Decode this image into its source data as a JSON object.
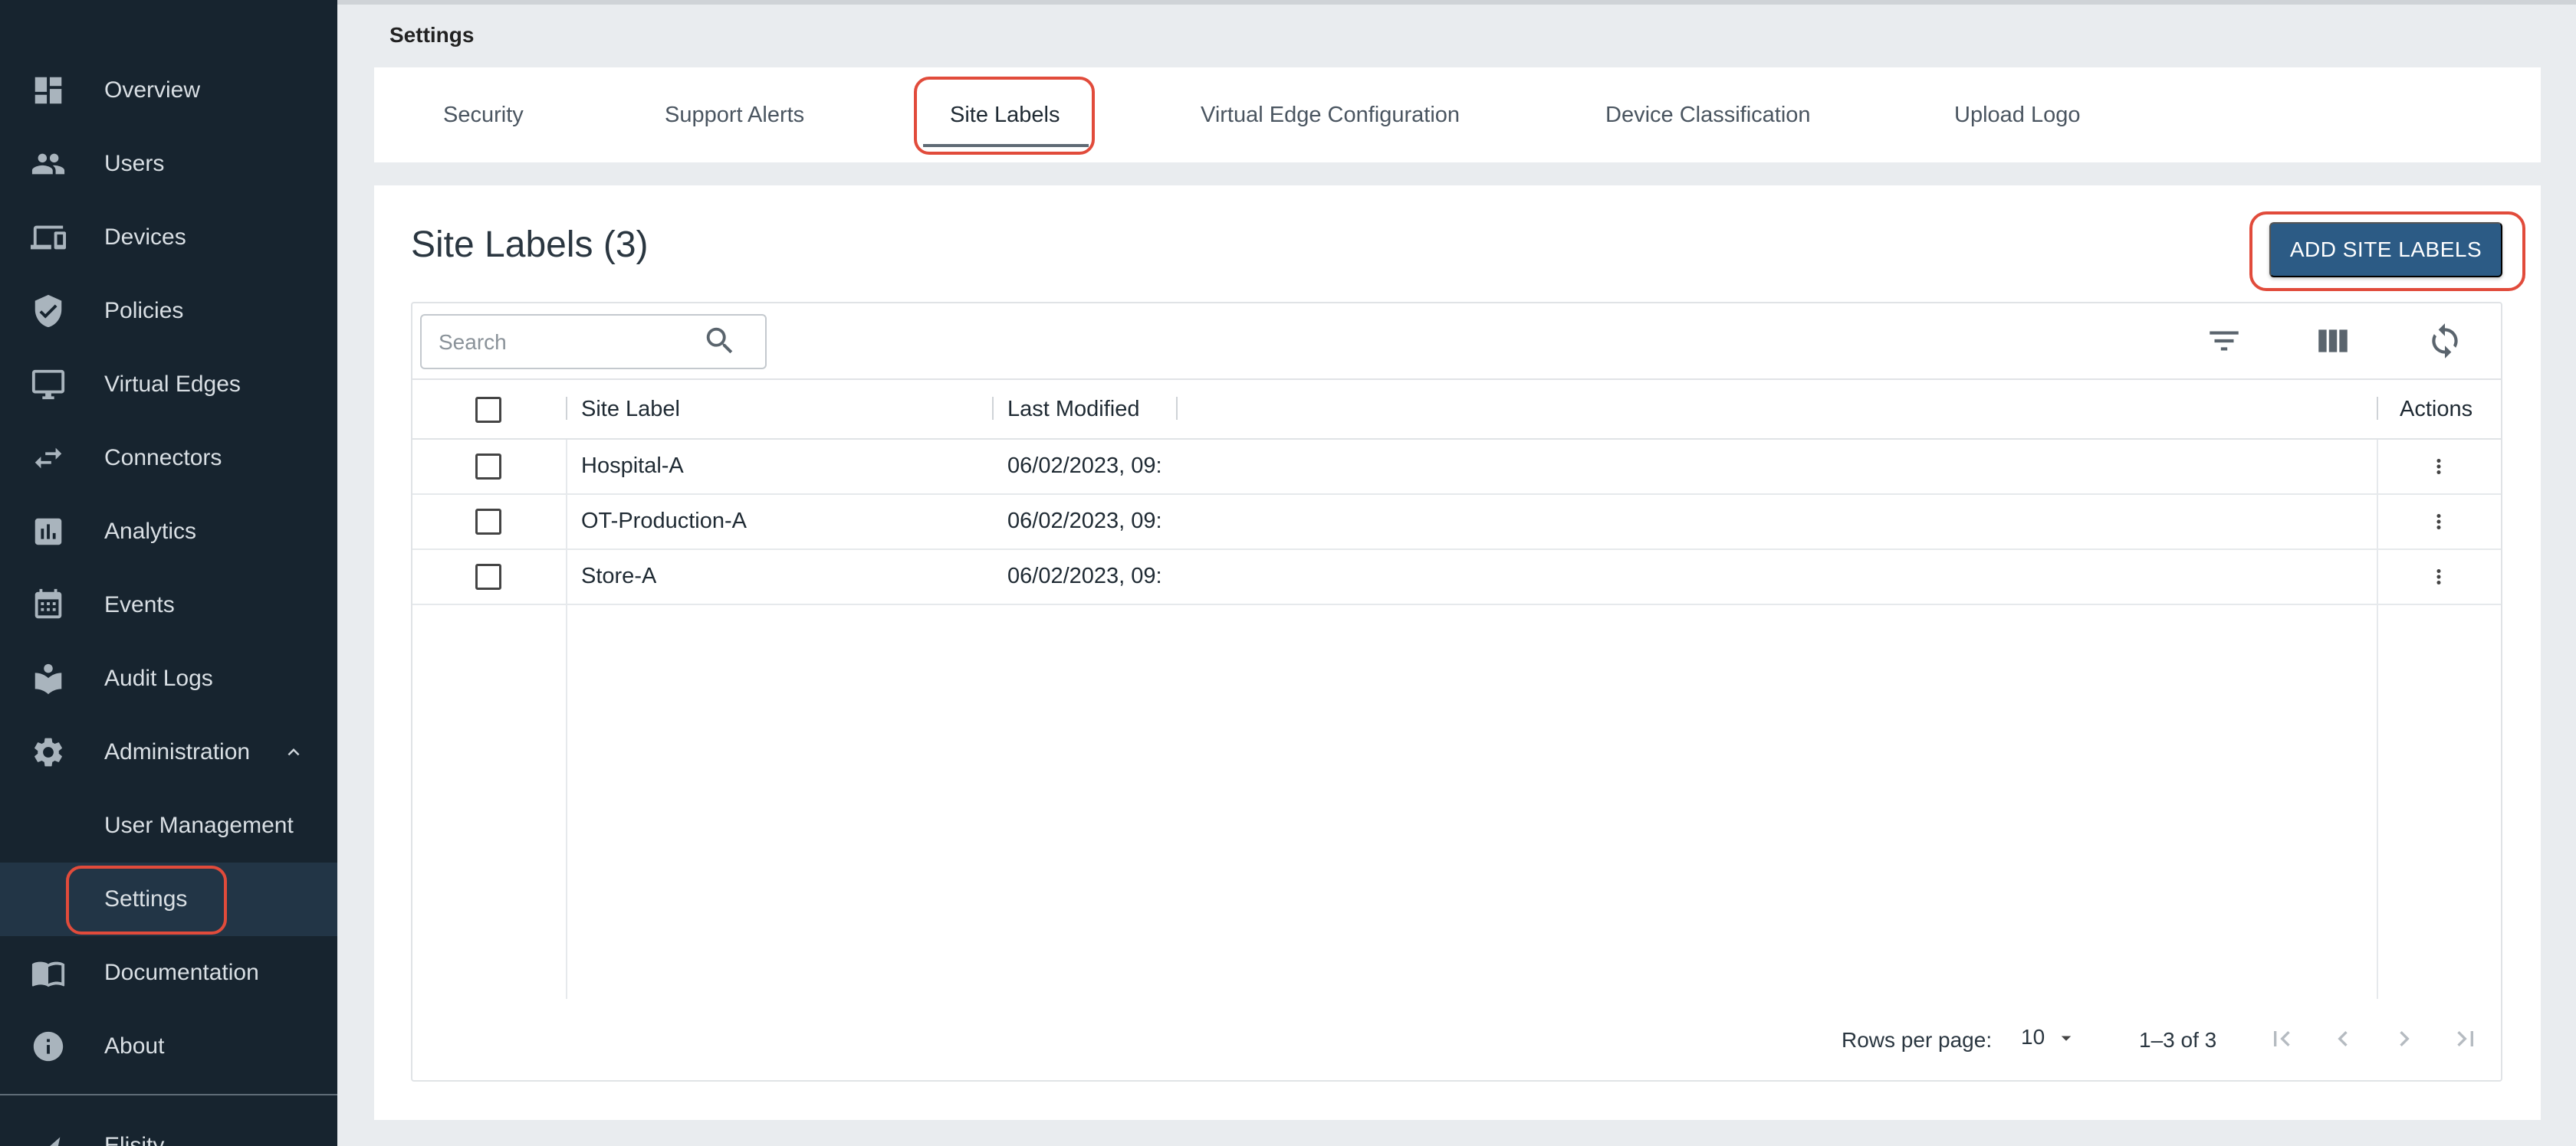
{
  "sidebar": {
    "items": [
      {
        "label": "Overview",
        "icon": "dashboard-icon"
      },
      {
        "label": "Users",
        "icon": "users-icon"
      },
      {
        "label": "Devices",
        "icon": "devices-icon"
      },
      {
        "label": "Policies",
        "icon": "shield-check-icon"
      },
      {
        "label": "Virtual Edges",
        "icon": "monitor-icon"
      },
      {
        "label": "Connectors",
        "icon": "swap-arrows-icon"
      },
      {
        "label": "Analytics",
        "icon": "bar-chart-icon"
      },
      {
        "label": "Events",
        "icon": "calendar-icon"
      },
      {
        "label": "Audit Logs",
        "icon": "book-icon"
      },
      {
        "label": "Administration",
        "icon": "gear-icon"
      },
      {
        "label": "User Management"
      },
      {
        "label": "Settings",
        "selected": true
      },
      {
        "label": "Documentation",
        "icon": "menu-book-icon"
      },
      {
        "label": "About",
        "icon": "info-icon"
      }
    ],
    "footer_label": "Elisity"
  },
  "page": {
    "title": "Settings"
  },
  "tabs": [
    {
      "label": "Security"
    },
    {
      "label": "Support Alerts"
    },
    {
      "label": "Site Labels",
      "active": true
    },
    {
      "label": "Virtual Edge Configuration"
    },
    {
      "label": "Device Classification"
    },
    {
      "label": "Upload Logo"
    }
  ],
  "section": {
    "title": "Site Labels (3)",
    "add_button_label": "ADD SITE LABELS"
  },
  "search": {
    "placeholder": "Search",
    "value": ""
  },
  "table": {
    "columns": [
      "Site Label",
      "Last Modified",
      "Actions"
    ],
    "rows": [
      {
        "site_label": "Hospital-A",
        "last_modified": "06/02/2023, 09:"
      },
      {
        "site_label": "OT-Production-A",
        "last_modified": "06/02/2023, 09:"
      },
      {
        "site_label": "Store-A",
        "last_modified": "06/02/2023, 09:"
      }
    ]
  },
  "pagination": {
    "rows_per_page_label": "Rows per page:",
    "rows_per_page_value": "10",
    "range_label": "1–3 of 3"
  },
  "colors": {
    "sidebar_bg": "#17242f",
    "accent_button": "#2c5b85",
    "highlight_outline": "#e14b3b"
  }
}
